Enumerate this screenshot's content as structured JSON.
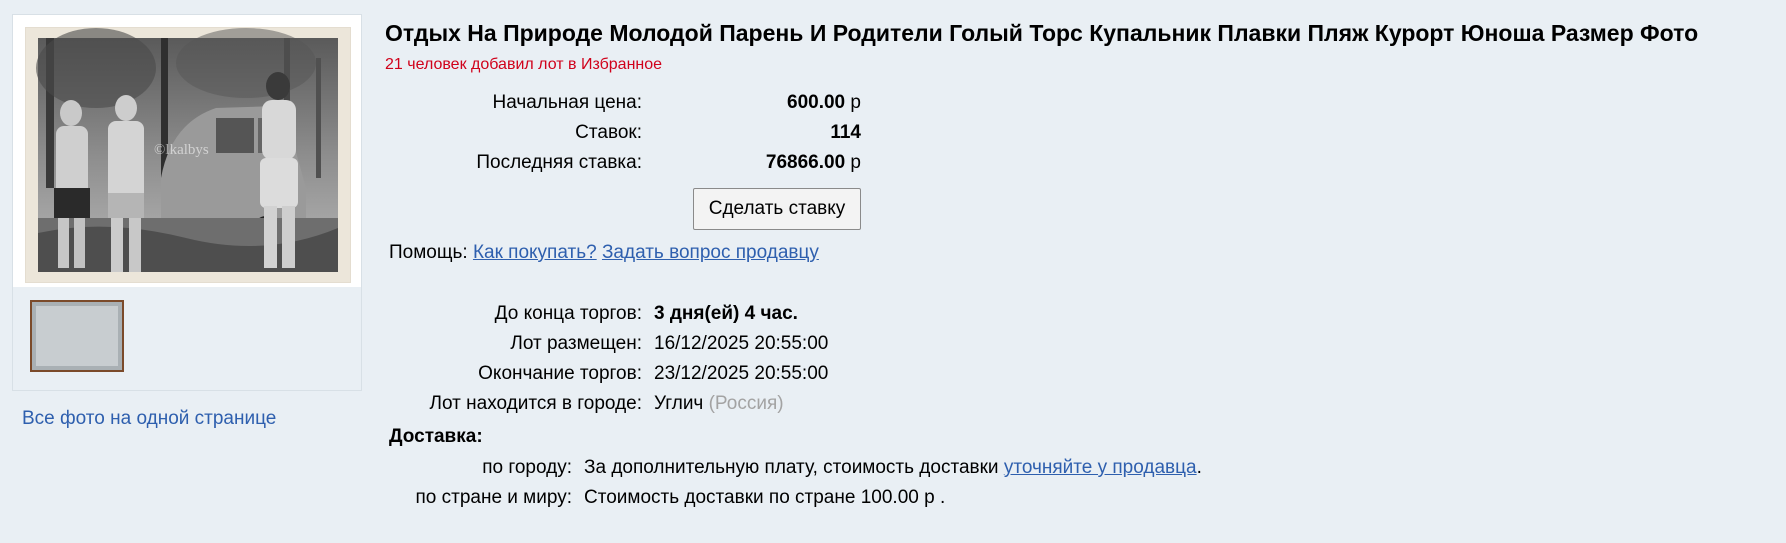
{
  "gallery": {
    "all_photos_link": "Все фото на одной странице",
    "watermark": "©lkalbys"
  },
  "lot": {
    "title": "Отдых На Природе Молодой Парень И Родители Голый Торс Купальник Плавки Пляж Курорт Юноша Размер Фото",
    "favorites_note": "21 человек добавил лот в Избранное"
  },
  "pricing": {
    "start_price_label": "Начальная цена:",
    "start_price_value": "600.00",
    "currency": "р",
    "bids_label": "Ставок:",
    "bids_value": "114",
    "last_bid_label": "Последняя ставка:",
    "last_bid_value": "76866.00",
    "bid_button": "Сделать ставку"
  },
  "help": {
    "label": "Помощь:",
    "how_to_buy": "Как покупать?",
    "ask_seller": "Задать вопрос продавцу"
  },
  "info": {
    "ends_in_label": "До конца торгов:",
    "ends_in_value": "3 дня(ей) 4 час.",
    "posted_label": "Лот размещен:",
    "posted_value": "16/12/2025 20:55:00",
    "end_label": "Окончание торгов:",
    "end_value": "23/12/2025 20:55:00",
    "city_label": "Лот находится в городе:",
    "city_value": "Углич",
    "country_value": "(Россия)"
  },
  "delivery": {
    "heading": "Доставка:",
    "city_label": "по городу:",
    "city_text": "За дополнительную плату, стоимость доставки",
    "city_link": "уточняйте у продавца",
    "world_label": "по стране и миру:",
    "world_text": "Стоимость доставки по стране 100.00 р ."
  },
  "colors": {
    "background": "#e9eff4",
    "link": "#2e5fae",
    "favorites_note": "#d0021b"
  }
}
